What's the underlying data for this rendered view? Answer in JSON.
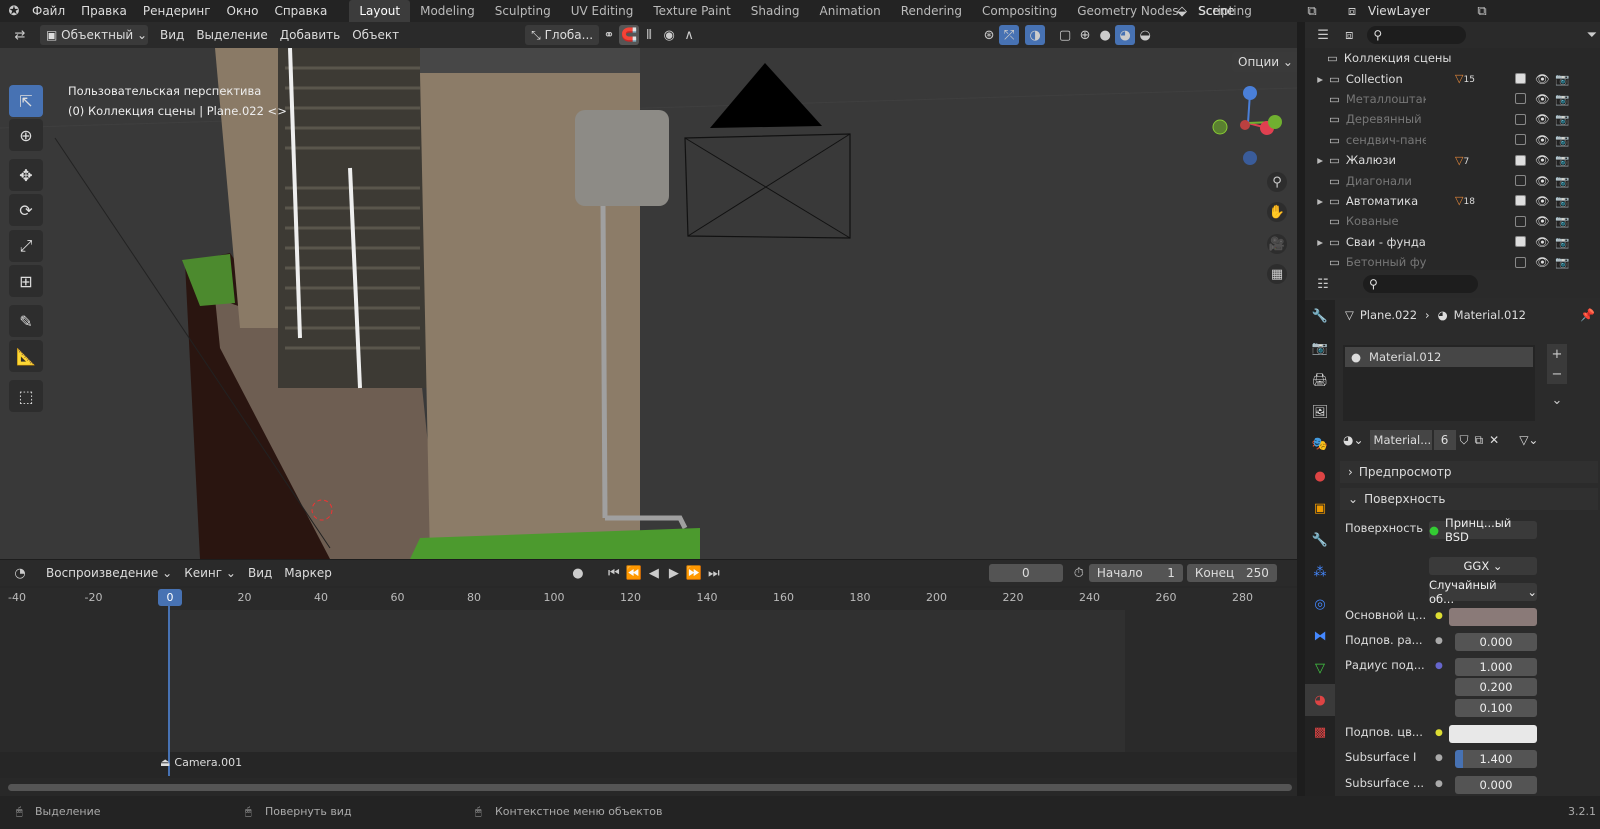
{
  "topbar": {
    "menus": [
      "Файл",
      "Правка",
      "Рендеринг",
      "Окно",
      "Справка"
    ],
    "workspaces": [
      "Layout",
      "Modeling",
      "Sculpting",
      "UV Editing",
      "Texture Paint",
      "Shading",
      "Animation",
      "Rendering",
      "Compositing",
      "Geometry Nodes",
      "Scripting"
    ],
    "active_workspace": "Layout",
    "scene": "Scene",
    "view_layer": "ViewLayer"
  },
  "viewport_header": {
    "mode": "Объектный",
    "menus": [
      "Вид",
      "Выделение",
      "Добавить",
      "Объект"
    ],
    "transform": "Глоба...",
    "options": "Опции"
  },
  "viewport": {
    "perspective": "Пользовательская перспектива",
    "collection_info": "(0) Коллекция сцены | Plane.022 <>"
  },
  "outliner": {
    "root": "Коллекция сцены",
    "items": [
      {
        "name": "Collection",
        "expand": true,
        "badge": "15",
        "active": true,
        "checked": true
      },
      {
        "name": "Металлоштакетник",
        "expand": false,
        "badge": "",
        "active": false,
        "checked": false
      },
      {
        "name": "Деревянный",
        "expand": false,
        "badge": "",
        "active": false,
        "checked": false
      },
      {
        "name": "сендвич-панель",
        "expand": false,
        "badge": "",
        "active": false,
        "checked": false
      },
      {
        "name": "Жалюзи",
        "expand": true,
        "badge": "7",
        "active": true,
        "checked": true
      },
      {
        "name": "Диагонали",
        "expand": false,
        "badge": "",
        "active": false,
        "checked": false
      },
      {
        "name": "Автоматика",
        "expand": true,
        "badge": "18",
        "active": true,
        "checked": true
      },
      {
        "name": "Кованые",
        "expand": false,
        "badge": "",
        "active": false,
        "checked": false
      },
      {
        "name": "Сваи - фундамент",
        "expand": true,
        "badge": "",
        "active": true,
        "checked": true
      },
      {
        "name": "Бетонный фундамент",
        "expand": false,
        "badge": "",
        "active": false,
        "checked": false
      }
    ]
  },
  "properties": {
    "object": "Plane.022",
    "material": "Material.012",
    "slot": "Material.012",
    "material_field": "Material...",
    "users": "6",
    "preview": "Предпросмотр",
    "surface_panel": "Поверхность",
    "rows": [
      {
        "label": "Поверхность",
        "value": "Принц...ый BSD"
      },
      {
        "label": "",
        "value": "GGX"
      },
      {
        "label": "",
        "value": "Случайный об..."
      },
      {
        "label": "Основной ц...",
        "value": ""
      },
      {
        "label": "Подпов. ра...",
        "value": "0.000"
      },
      {
        "label": "Радиус под...",
        "value": "1.000"
      },
      {
        "label": "",
        "value": "0.200"
      },
      {
        "label": "",
        "value": "0.100"
      },
      {
        "label": "Подпов. цв...",
        "value": ""
      },
      {
        "label": "Subsurface I",
        "value": "1.400"
      },
      {
        "label": "Subsurface ...",
        "value": "0.000"
      }
    ],
    "colors": {
      "base": "#8a7a78",
      "subsurface": "#e8e8e8"
    }
  },
  "timeline": {
    "menus": [
      "Воспроизведение",
      "Кеинг",
      "Вид",
      "Маркер"
    ],
    "current_frame": "0",
    "start_label": "Начало",
    "start": "1",
    "end_label": "Конец",
    "end": "250",
    "ticks": [
      "-40",
      "-20",
      "0",
      "20",
      "40",
      "60",
      "80",
      "100",
      "120",
      "140",
      "160",
      "180",
      "200",
      "220",
      "240",
      "260",
      "280"
    ],
    "marker": "Camera.001"
  },
  "status": {
    "items": [
      "Выделение",
      "Повернуть вид",
      "Контекстное меню объектов"
    ],
    "version": "3.2.1"
  }
}
